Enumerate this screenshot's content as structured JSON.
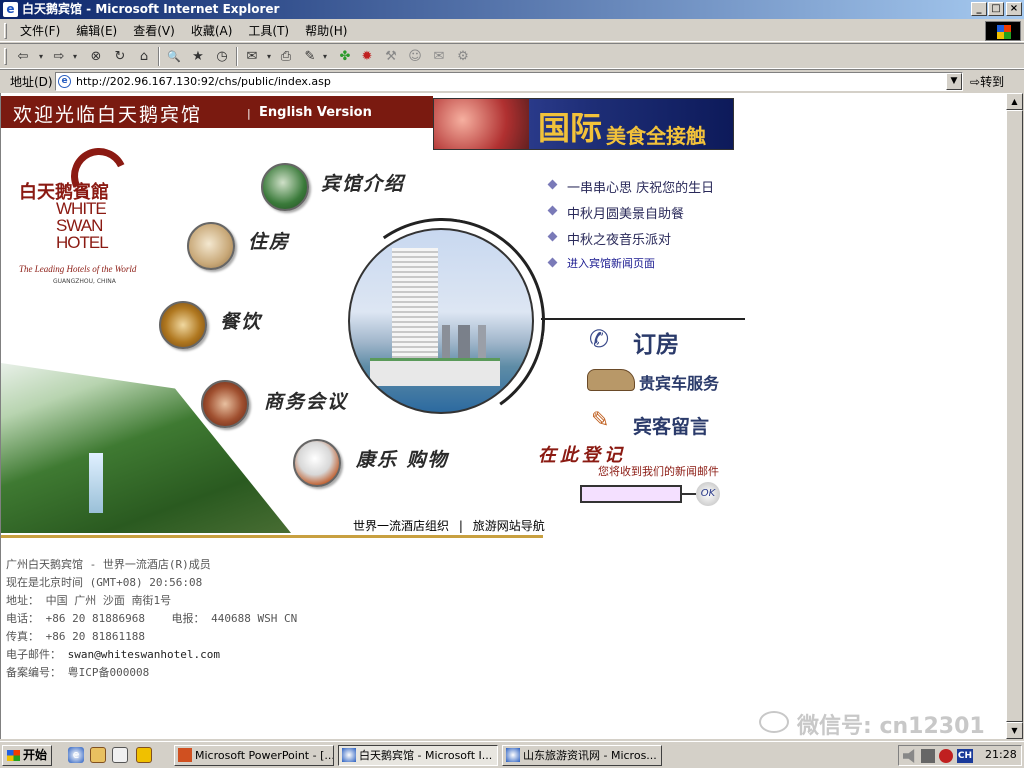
{
  "window": {
    "title": "白天鹅宾馆 - Microsoft Internet Explorer",
    "min_glyph": "_",
    "max_glyph": "□",
    "close_glyph": "×"
  },
  "menu": [
    "文件(F)",
    "编辑(E)",
    "查看(V)",
    "收藏(A)",
    "工具(T)",
    "帮助(H)"
  ],
  "toolbar": {
    "back": "⇦",
    "forward": "⇨",
    "stop": "⊗",
    "refresh": "↻",
    "home": "⌂",
    "search": "🔍",
    "favorites": "★",
    "history": "◷",
    "mail": "✉",
    "print": "⎙",
    "edit": "✎"
  },
  "address": {
    "label": "地址(D)",
    "url": "http://202.96.167.130:92/chs/public/index.asp",
    "go_label": "转到"
  },
  "header": {
    "welcome": "欢迎光临白天鹅宾馆",
    "separator": "|",
    "english": "English Version",
    "banner_big": "国际",
    "banner_small": "美食全接触"
  },
  "logo": {
    "cn": "白天鹅賓館",
    "en": "WHITE SWAN HOTEL",
    "leading": "The Leading Hotels of the World",
    "city": "GUANGZHOU, CHINA"
  },
  "nav": {
    "intro": "宾馆介绍",
    "rooms": "住房",
    "dining": "餐饮",
    "business": "商务会议",
    "leisure": "康乐 购物"
  },
  "news": {
    "items": [
      "一串串心思 庆祝您的生日",
      "中秋月圆美景自助餐",
      "中秋之夜音乐派对"
    ],
    "link": "进入宾馆新闻页面"
  },
  "services": {
    "booking": "订房",
    "car": "贵宾车服务",
    "guestbook": "宾客留言"
  },
  "register": {
    "title": "在此登记",
    "subtitle": "您将收到我们的新闻邮件",
    "ok": "OK"
  },
  "footer_links": {
    "a": "世界一流酒店组织",
    "sep": "|",
    "b": "旅游网站导航"
  },
  "info": {
    "line1": "广州白天鹅宾馆 - 世界一流酒店(R)成员",
    "line2": "现在是北京时间 (GMT+08) 20:56:08",
    "addr_label": "地址：",
    "addr_value": "中国 广州 沙面 南街1号",
    "tel_label": "电话：",
    "tel_value": "+86 20 81886968",
    "telex_label": "电报：",
    "telex_value": "440688 WSH CN",
    "fax_label": "传真：",
    "fax_value": "+86 20 81861188",
    "email_label": "电子邮件：",
    "email_value": "swan@whiteswanhotel.com",
    "icp_label": "备案编号：",
    "icp_value": "粤ICP备000008"
  },
  "watermark": "微信号: cn12301",
  "taskbar": {
    "start": "开始",
    "tasks": [
      "Microsoft PowerPoint - [...",
      "白天鹅宾馆 - Microsoft I...",
      "山东旅游资讯网 - Micros..."
    ],
    "clock": "21:28",
    "lang": "CH"
  },
  "colors": {
    "brand_red": "#7a1a10",
    "banner_gold": "#f2c23a",
    "title_blue": "#0a246a"
  }
}
